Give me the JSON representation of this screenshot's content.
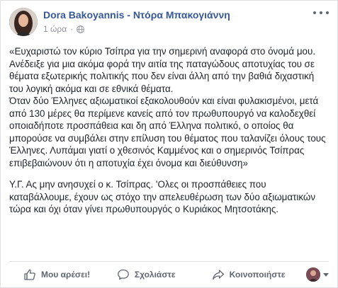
{
  "post": {
    "author": "Dora Bakoyannis - Ντόρα Μπακογιάννη",
    "time": "1 ώρα",
    "meta_sep": "·",
    "paragraphs": [
      "«Ευχαριστώ τον κύριο Τσίπρα για την σημερινή αναφορά στο όνομά μου. Ανέδειξε για μια ακόμα φορά την αιτία της παταγώδους αποτυχίας του σε θέματα εξωτερικής πολιτικής που δεν είναι άλλη από την βαθιά διχαστική του λογική ακόμα και σε εθνικά θέματα.\nΌταν δύο Έλληνες αξιωματικοί εξακολουθούν και είναι φυλακισμένοι, μετά από 130 μέρες θα περίμενε κανείς από τον πρωθυπουργό να καλοδεχθεί οποιαδήποτε προσπάθεια και δη από Έλληνα πολιτικό, ο οποίος θα μπορούσε να συμβάλει στην επίλυση του θέματος που ταλανίζει όλους τους Έλληνες. Λυπάμαι γιατί ο χθεσινός Καμμένος και ο σημερινός Τσίπρας επιβεβαιώνουν ότι η αποτυχία έχει όνομα και διεύθυνση»",
      "Υ.Γ. Ας μην ανησυχεί ο κ. Τσίπρας. 'Ολες οι προσπάθειες που καταβάλλουμε, έχουν ως στόχο την απελευθέρωση των δύο αξιωματικών τώρα και όχι όταν γίνει πρωθυπουργός ο Κυριάκος Μητσοτάκης."
    ]
  },
  "actions": {
    "like": "Μου αρέσει!",
    "comment": "Σχολιάστε",
    "share": "Κοινοποιήστε"
  },
  "icons": {
    "globe": "globe-icon",
    "more": "more-options-icon",
    "like": "thumbs-up-icon",
    "comment": "comment-bubble-icon",
    "share": "share-arrow-icon"
  },
  "colors": {
    "author_link": "#365899",
    "text": "#1d2129",
    "muted": "#90949c",
    "action": "#606770"
  }
}
